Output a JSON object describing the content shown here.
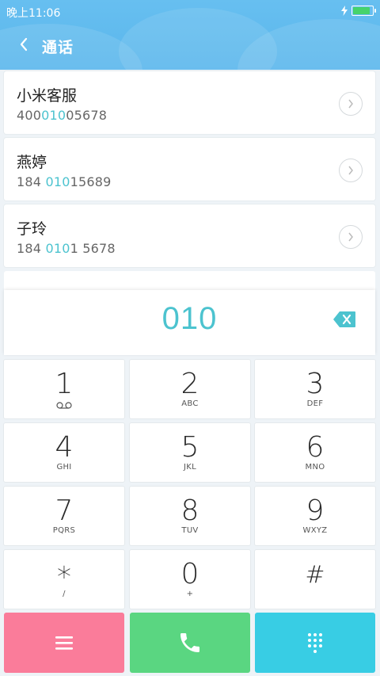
{
  "status_bar": {
    "time": "晚上11:06",
    "battery_level": 0.95,
    "charging_icon": "bolt-icon"
  },
  "header": {
    "title": "通话",
    "back_icon": "chevron-left-icon"
  },
  "contacts": [
    {
      "name": "小米客服",
      "number_pre": "400",
      "number_match": "010",
      "number_post": "05678"
    },
    {
      "name": "燕婷",
      "number_pre": "184 ",
      "number_match": "010",
      "number_post": "15689"
    },
    {
      "name": "子玲",
      "number_pre": "184 ",
      "number_match": "010",
      "number_post": "1 5678"
    }
  ],
  "dialer": {
    "entered_number": "010",
    "keys": [
      {
        "digit": "1",
        "letters": ""
      },
      {
        "digit": "2",
        "letters": "ABC"
      },
      {
        "digit": "3",
        "letters": "DEF"
      },
      {
        "digit": "4",
        "letters": "GHI"
      },
      {
        "digit": "5",
        "letters": "JKL"
      },
      {
        "digit": "6",
        "letters": "MNO"
      },
      {
        "digit": "7",
        "letters": "PQRS"
      },
      {
        "digit": "8",
        "letters": "TUV"
      },
      {
        "digit": "9",
        "letters": "WXYZ"
      },
      {
        "digit": "*",
        "letters": "/"
      },
      {
        "digit": "0",
        "letters": "+"
      },
      {
        "digit": "#",
        "letters": ""
      }
    ]
  },
  "actions": [
    {
      "name": "menu",
      "icon": "menu-icon",
      "color": "#fa7c9a"
    },
    {
      "name": "call",
      "icon": "phone-icon",
      "color": "#5ad681"
    },
    {
      "name": "keypad",
      "icon": "dialpad-icon",
      "color": "#38cde4"
    }
  ],
  "colors": {
    "accent": "#4cc3cf",
    "header": "#5ab6ec"
  }
}
